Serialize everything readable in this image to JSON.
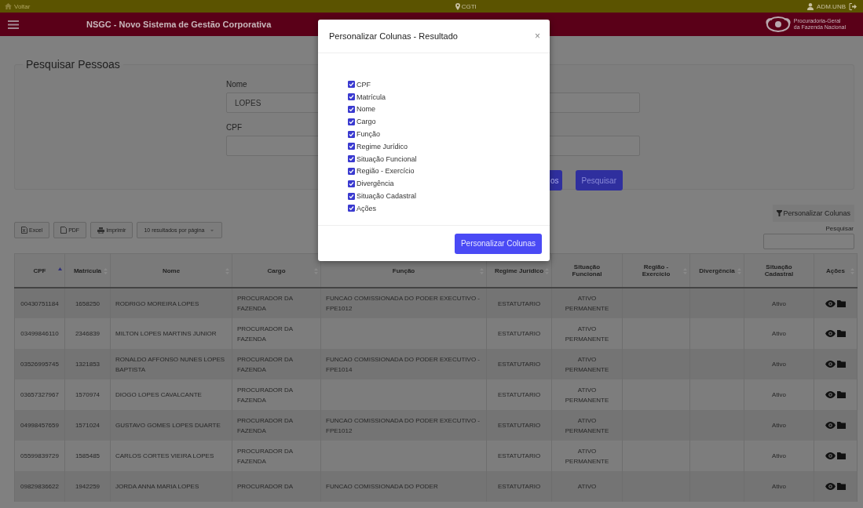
{
  "top_bar": {
    "back_link": "Voltar",
    "location": "CGTI",
    "user": "ADM.UNB"
  },
  "header": {
    "title": "NSGC - Novo Sistema de Gestão Corporativa",
    "logo_lines": [
      "Procuradoria-Geral",
      "da Fazenda Nacional"
    ]
  },
  "search_panel": {
    "title": "Pesquisar Pessoas",
    "fields": [
      {
        "label": "Nome",
        "value": "LOPES"
      },
      {
        "label": "CPF"
      }
    ],
    "buttons": [
      {
        "label": "os",
        "kind": "secondary"
      },
      {
        "label": "Pesquisar",
        "kind": "primary"
      }
    ]
  },
  "table_toolbar": {
    "buttons": [
      {
        "label": "Excel",
        "kind": "excel"
      },
      {
        "label": "PDF",
        "kind": "pdf"
      },
      {
        "label": "Imprimir",
        "kind": "print"
      },
      {
        "label": "10 resultados por página",
        "kind": "dropdown"
      }
    ],
    "customize_button": "Personalizar Colunas",
    "search_label": "Pesquisar"
  },
  "table": {
    "columns": [
      {
        "label": "CPF",
        "sortable": true,
        "sorted_ascending": true
      },
      {
        "label": "Matrícula",
        "sortable": true,
        "sorted_ascending": false
      },
      {
        "label": "Nome",
        "sortable": true,
        "sorted_ascending": false
      },
      {
        "label": "Cargo",
        "sortable": true,
        "sorted_ascending": false
      },
      {
        "label": "Função",
        "sortable": true,
        "sorted_ascending": false
      },
      {
        "label": "Regime Jurídico",
        "sortable": true,
        "sorted_ascending": false
      },
      {
        "label": "Situação Funcional",
        "sortable": false,
        "sorted_ascending": false
      },
      {
        "label": "Região - Exercício",
        "sortable": true,
        "sorted_ascending": false
      },
      {
        "label": "Divergência",
        "sortable": true,
        "sorted_ascending": false
      },
      {
        "label": "Situação Cadastral",
        "sortable": false,
        "sorted_ascending": false
      },
      {
        "label": "Ações",
        "sortable": true,
        "sorted_ascending": false
      }
    ],
    "rows": [
      {
        "cpf": "00430751184",
        "matricula": "1658250",
        "nome": "RODRIGO MOREIRA LOPES",
        "cargo": "PROCURADOR DA FAZENDA",
        "funcao": "FUNCAO COMISSIONADA DO PODER EXECUTIVO - FPE1012",
        "regime": "ESTATUTARIO",
        "situacao_funcional": "ATIVO PERMANENTE",
        "situacao_cadastral": "Ativo"
      },
      {
        "cpf": "03499846110",
        "matricula": "2346839",
        "nome": "MILTON LOPES MARTINS JUNIOR",
        "cargo": "PROCURADOR DA FAZENDA",
        "regime": "ESTATUTARIO",
        "situacao_funcional": "ATIVO PERMANENTE",
        "situacao_cadastral": "Ativo"
      },
      {
        "cpf": "03526995745",
        "matricula": "1321853",
        "nome": "RONALDO AFFONSO NUNES LOPES BAPTISTA",
        "cargo": "PROCURADOR DA FAZENDA",
        "funcao": "FUNCAO COMISSIONADA DO PODER EXECUTIVO - FPE1014",
        "regime": "ESTATUTARIO",
        "situacao_funcional": "ATIVO PERMANENTE",
        "situacao_cadastral": "Ativo"
      },
      {
        "cpf": "03657327967",
        "matricula": "1570974",
        "nome": "DIOGO LOPES CAVALCANTE",
        "cargo": "PROCURADOR DA FAZENDA",
        "regime": "ESTATUTARIO",
        "situacao_funcional": "ATIVO PERMANENTE",
        "situacao_cadastral": "Ativo"
      },
      {
        "cpf": "04998457659",
        "matricula": "1571024",
        "nome": "GUSTAVO GOMES LOPES DUARTE",
        "cargo": "PROCURADOR DA FAZENDA",
        "funcao": "FUNCAO COMISSIONADA DO PODER EXECUTIVO - FPE1012",
        "regime": "ESTATUTARIO",
        "situacao_funcional": "ATIVO PERMANENTE",
        "situacao_cadastral": "Ativo"
      },
      {
        "cpf": "05599839729",
        "matricula": "1585485",
        "nome": "CARLOS CORTES VIEIRA LOPES",
        "cargo": "PROCURADOR DA FAZENDA",
        "regime": "ESTATUTARIO",
        "situacao_funcional": "ATIVO PERMANENTE",
        "situacao_cadastral": "Ativo"
      },
      {
        "cpf": "09829836622",
        "matricula": "1942259",
        "nome": "JORDA ANNA MARIA LOPES",
        "cargo": "PROCURADOR DA",
        "funcao": "FUNCAO COMISSIONADA DO PODER",
        "regime": "ESTATUTARIO",
        "situacao_funcional": "ATIVO",
        "situacao_cadastral": "Ativo"
      }
    ]
  },
  "modal": {
    "title": "Personalizar Colunas - Resultado",
    "close": "×",
    "options": [
      {
        "label": "CPF",
        "checked": true
      },
      {
        "label": "Matrícula",
        "checked": true
      },
      {
        "label": "Nome",
        "checked": true
      },
      {
        "label": "Cargo",
        "checked": true
      },
      {
        "label": "Função",
        "checked": true
      },
      {
        "label": "Regime Jurídico",
        "checked": true
      },
      {
        "label": "Situação Funcional",
        "checked": true
      },
      {
        "label": "Região - Exercício",
        "checked": true
      },
      {
        "label": "Divergência",
        "checked": true
      },
      {
        "label": "Situação Cadastral",
        "checked": true
      },
      {
        "label": "Ações",
        "checked": true
      }
    ],
    "button": "Personalizar Colunas"
  }
}
